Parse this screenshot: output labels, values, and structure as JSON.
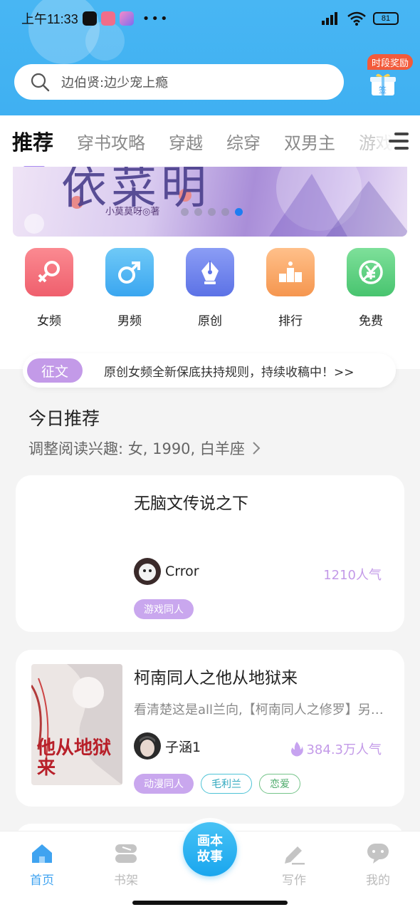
{
  "status_bar": {
    "time": "上午11:33",
    "more": "•••",
    "battery": "81"
  },
  "search": {
    "placeholder": "边伯贤:边少宠上瘾"
  },
  "signin": {
    "badge": "时段奖励",
    "gift_label": "签"
  },
  "tabs": [
    {
      "label": "推荐"
    },
    {
      "label": "穿书攻略"
    },
    {
      "label": "穿越"
    },
    {
      "label": "综穿"
    },
    {
      "label": "双男主"
    },
    {
      "label": "游戏"
    }
  ],
  "banner": {
    "title": "依菜明",
    "author": "小莫莫呀◎著",
    "dot_count": 5,
    "active_dot": 4
  },
  "categories": [
    {
      "label": "女频",
      "icon": "female-icon",
      "color": "#f5737e"
    },
    {
      "label": "男频",
      "icon": "male-icon",
      "color": "#4ab3f3"
    },
    {
      "label": "原创",
      "icon": "pen-nib-icon",
      "color": "#6f86ee"
    },
    {
      "label": "排行",
      "icon": "podium-icon",
      "color": "#f7a867"
    },
    {
      "label": "免费",
      "icon": "free-yen-icon",
      "color": "#5ccf7e"
    }
  ],
  "notice": {
    "tag": "征文",
    "text": "原创女频全新保底扶持规则，持续收稿中！>>"
  },
  "today": {
    "title": "今日推荐",
    "subtitle": "调整阅读兴趣: 女, 1990, 白羊座"
  },
  "books": [
    {
      "title": "无脑文传说之下",
      "description": "",
      "author": "Crror",
      "popularity": "1210人气",
      "tags": [
        "游戏同人"
      ]
    },
    {
      "title": "柯南同人之他从地狱来",
      "description": "看清楚这是all兰向,【柯南同人之修罗】另外...",
      "author": "子涵1",
      "popularity": "384.3万人气",
      "tags": [
        "动漫同人",
        "毛利兰",
        "恋爱"
      ],
      "cover_text": "他从地狱来"
    }
  ],
  "bottom_nav": {
    "home": "首页",
    "shelf": "书架",
    "fab": "画本故事",
    "write": "写作",
    "mine": "我的"
  }
}
